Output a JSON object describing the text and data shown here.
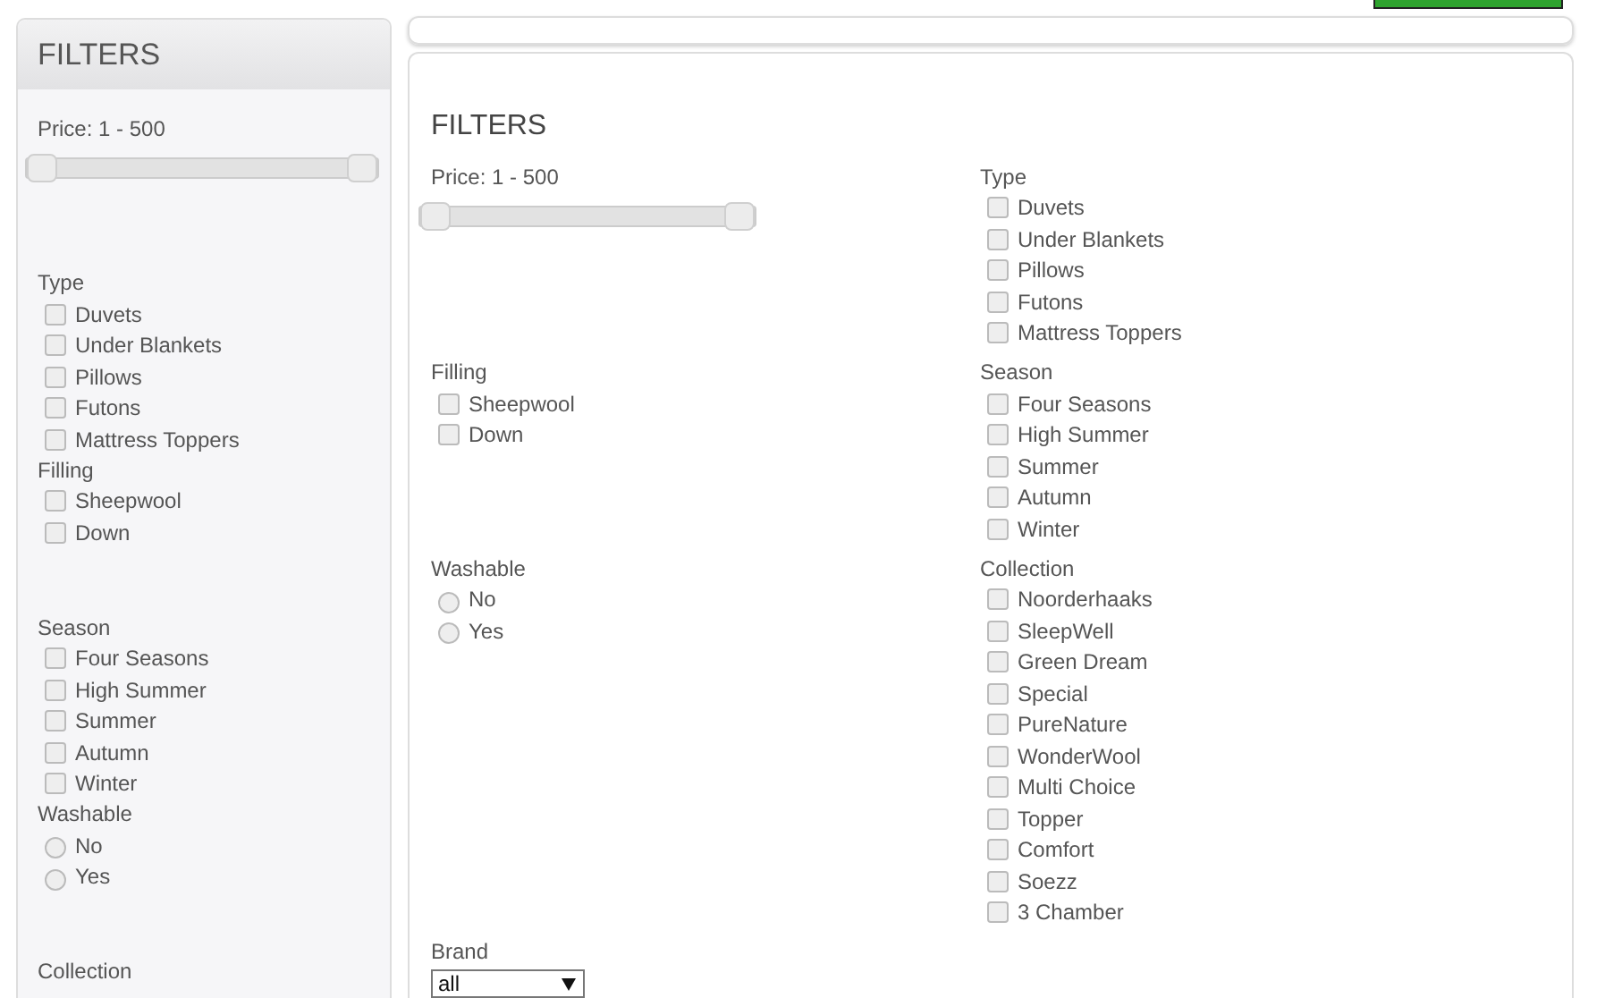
{
  "sidebar": {
    "title": "FILTERS",
    "sections": [
      {
        "kind": "slider",
        "title": "Price: 1 - 500",
        "handles": [
          {
            "level": 0
          },
          {
            "level": 1
          }
        ]
      },
      {
        "kind": "checkbox",
        "title": "Type",
        "options": [
          {
            "label": "Duvets",
            "checked": false
          },
          {
            "label": "Under Blankets",
            "checked": false
          },
          {
            "label": "Pillows",
            "checked": false
          },
          {
            "label": "Futons",
            "checked": false
          },
          {
            "label": "Mattress Toppers",
            "checked": false
          }
        ]
      },
      {
        "kind": "checkbox",
        "title": "Filling",
        "options": [
          {
            "label": "Sheepwool",
            "checked": false
          },
          {
            "label": "Down",
            "checked": false
          }
        ]
      },
      {
        "kind": "checkbox",
        "title": "Season",
        "options": [
          {
            "label": "Four Seasons",
            "checked": false
          },
          {
            "label": "High Summer",
            "checked": false
          },
          {
            "label": "Summer",
            "checked": false
          },
          {
            "label": "Autumn",
            "checked": false
          },
          {
            "label": "Winter",
            "checked": false
          }
        ]
      },
      {
        "kind": "radio",
        "title": "Washable",
        "options": [
          {
            "label": "No",
            "selected": false
          },
          {
            "label": "Yes",
            "selected": false
          }
        ]
      },
      {
        "kind": "checkbox",
        "title": "Collection"
      }
    ]
  },
  "main": {
    "title": "FILTERS",
    "sections": [
      {
        "kind": "slider",
        "title": "Price: 1 - 500",
        "handles": [
          {
            "level": 0
          },
          {
            "level": 1
          }
        ]
      },
      {
        "kind": "checkbox",
        "title": "Type",
        "options": [
          {
            "label": "Duvets",
            "checked": false
          },
          {
            "label": "Under Blankets",
            "checked": false
          },
          {
            "label": "Pillows",
            "checked": false
          },
          {
            "label": "Futons",
            "checked": false
          },
          {
            "label": "Mattress Toppers",
            "checked": false
          }
        ]
      },
      {
        "kind": "checkbox",
        "title": "Filling",
        "options": [
          {
            "label": "Sheepwool",
            "checked": false
          },
          {
            "label": "Down",
            "checked": false
          }
        ]
      },
      {
        "kind": "checkbox",
        "title": "Season",
        "options": [
          {
            "label": "Four Seasons",
            "checked": false
          },
          {
            "label": "High Summer",
            "checked": false
          },
          {
            "label": "Summer",
            "checked": false
          },
          {
            "label": "Autumn",
            "checked": false
          },
          {
            "label": "Winter",
            "checked": false
          }
        ]
      },
      {
        "kind": "radio",
        "title": "Washable",
        "options": [
          {
            "label": "No",
            "selected": false
          },
          {
            "label": "Yes",
            "selected": false
          }
        ]
      },
      {
        "kind": "checkbox",
        "title": "Collection",
        "options": [
          {
            "label": "Noorderhaaks",
            "checked": false
          },
          {
            "label": "SleepWell",
            "checked": false
          },
          {
            "label": "Green Dream",
            "checked": false
          },
          {
            "label": "Special",
            "checked": false
          },
          {
            "label": "PureNature",
            "checked": false
          },
          {
            "label": "WonderWool",
            "checked": false
          },
          {
            "label": "Multi Choice",
            "checked": false
          },
          {
            "label": "Topper",
            "checked": false
          },
          {
            "label": "Comfort",
            "checked": false
          },
          {
            "label": "Soezz",
            "checked": false
          },
          {
            "label": "3 Chamber",
            "checked": false
          }
        ]
      },
      {
        "kind": "select",
        "title": "Brand",
        "value": "all"
      }
    ]
  }
}
